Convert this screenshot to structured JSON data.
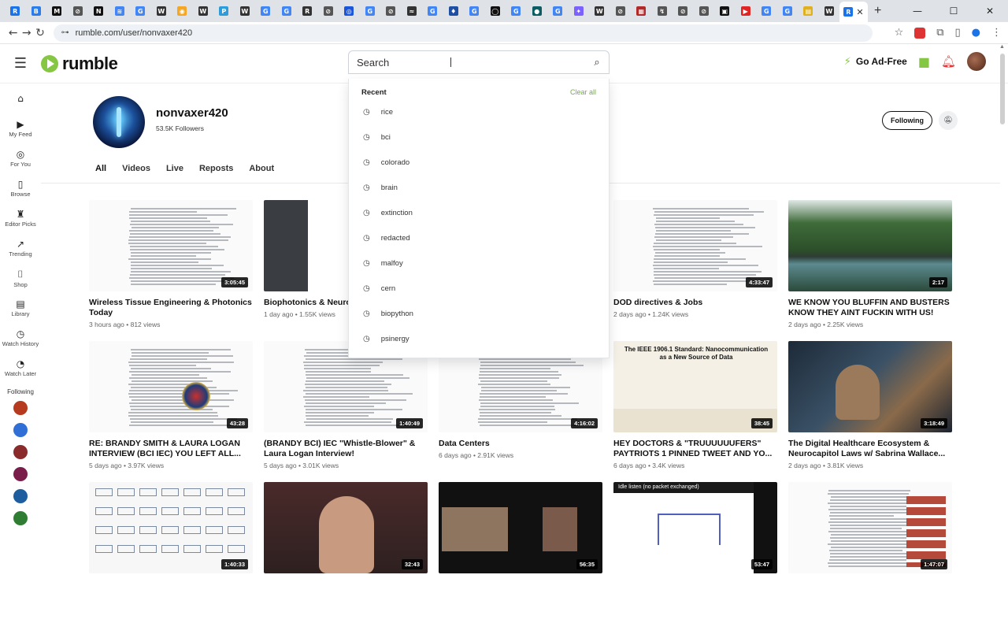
{
  "browser": {
    "tab_favicons": [
      {
        "color": "#1a73e8",
        "glyph": "R",
        "name": "rumble-tab-icon"
      },
      {
        "color": "#2b7de9",
        "glyph": "B",
        "name": "tab-icon-b"
      },
      {
        "color": "#111111",
        "glyph": "M",
        "name": "tab-icon-m"
      },
      {
        "color": "#555555",
        "glyph": "⊘",
        "name": "tab-icon-circle"
      },
      {
        "color": "#111111",
        "glyph": "N",
        "name": "tab-icon-n"
      },
      {
        "color": "#4285f4",
        "glyph": "≋",
        "name": "tab-icon-wave"
      },
      {
        "color": "#4285f4",
        "glyph": "G",
        "name": "google-tab-icon"
      },
      {
        "color": "#333333",
        "glyph": "W",
        "name": "wikipedia-tab-icon"
      },
      {
        "color": "#f5a623",
        "glyph": "◉",
        "name": "tab-icon-orange"
      },
      {
        "color": "#333333",
        "glyph": "W",
        "name": "wikipedia-tab-icon"
      },
      {
        "color": "#2d9cdb",
        "glyph": "P",
        "name": "tab-icon-pm"
      },
      {
        "color": "#333333",
        "glyph": "W",
        "name": "wikipedia-tab-icon"
      },
      {
        "color": "#4285f4",
        "glyph": "G",
        "name": "google-tab-icon"
      },
      {
        "color": "#4285f4",
        "glyph": "G",
        "name": "google-tab-icon"
      },
      {
        "color": "#333333",
        "glyph": "R",
        "name": "tab-icon-r"
      },
      {
        "color": "#555555",
        "glyph": "⊘",
        "name": "tab-icon-circle"
      },
      {
        "color": "#1a56db",
        "glyph": "◎",
        "name": "tab-icon-globe"
      },
      {
        "color": "#4285f4",
        "glyph": "G",
        "name": "google-tab-icon"
      },
      {
        "color": "#555555",
        "glyph": "⊘",
        "name": "tab-icon-circle"
      },
      {
        "color": "#333333",
        "glyph": "≈",
        "name": "tab-icon-ncbi"
      },
      {
        "color": "#4285f4",
        "glyph": "G",
        "name": "google-tab-icon"
      },
      {
        "color": "#1f4fa3",
        "glyph": "♦",
        "name": "tab-icon-shield"
      },
      {
        "color": "#4285f4",
        "glyph": "G",
        "name": "google-tab-icon"
      },
      {
        "color": "#111111",
        "glyph": "◯",
        "name": "github-tab-icon"
      },
      {
        "color": "#4285f4",
        "glyph": "G",
        "name": "google-tab-icon"
      },
      {
        "color": "#0b5d63",
        "glyph": "●",
        "name": "tab-icon-teal"
      },
      {
        "color": "#4285f4",
        "glyph": "G",
        "name": "google-tab-icon"
      },
      {
        "color": "#7b61ff",
        "glyph": "✦",
        "name": "tab-icon-purple"
      },
      {
        "color": "#333333",
        "glyph": "W",
        "name": "wikipedia-tab-icon"
      },
      {
        "color": "#555555",
        "glyph": "⊘",
        "name": "tab-icon-circle"
      },
      {
        "color": "#b02a2a",
        "glyph": "▦",
        "name": "tab-icon-red"
      },
      {
        "color": "#555555",
        "glyph": "↯",
        "name": "tab-icon-plug"
      },
      {
        "color": "#555555",
        "glyph": "⊘",
        "name": "tab-icon-circle"
      },
      {
        "color": "#555555",
        "glyph": "⊘",
        "name": "tab-icon-circle"
      },
      {
        "color": "#111111",
        "glyph": "▣",
        "name": "tab-icon-square"
      },
      {
        "color": "#e02424",
        "glyph": "▶",
        "name": "youtube-tab-icon"
      },
      {
        "color": "#4285f4",
        "glyph": "G",
        "name": "google-tab-icon"
      },
      {
        "color": "#4285f4",
        "glyph": "G",
        "name": "google-tab-icon"
      },
      {
        "color": "#e0b020",
        "glyph": "▤",
        "name": "tab-icon-yellow"
      },
      {
        "color": "#333333",
        "glyph": "W",
        "name": "wikipedia-tab-icon"
      },
      {
        "color": "#1a73e8",
        "glyph": "R",
        "name": "rumble-tab-icon"
      }
    ],
    "url": "rumble.com/user/nonvaxer420"
  },
  "header": {
    "logo_text": "rumble",
    "search_placeholder": "Search",
    "ad_free_label": "Go Ad-Free"
  },
  "search_dropdown": {
    "heading": "Recent",
    "clear_label": "Clear all",
    "items": [
      "rice",
      "bci",
      "colorado",
      "brain",
      "extinction",
      "redacted",
      "malfoy",
      "cern",
      "biopython",
      "psinergy"
    ]
  },
  "sidebar": {
    "items": [
      {
        "icon": "⌂",
        "label": "",
        "name": "sidebar-item-home",
        "icon_name": "home-icon"
      },
      {
        "icon": "▶",
        "label": "My Feed",
        "name": "sidebar-item-my-feed",
        "icon_name": "feed-icon"
      },
      {
        "icon": "◎",
        "label": "For You",
        "name": "sidebar-item-for-you",
        "icon_name": "compass-icon"
      },
      {
        "icon": "▯",
        "label": "Browse",
        "name": "sidebar-item-browse",
        "icon_name": "browse-icon"
      },
      {
        "icon": "♜",
        "label": "Editor Picks",
        "name": "sidebar-item-editor-picks",
        "icon_name": "trophy-icon"
      },
      {
        "icon": "↗",
        "label": "Trending",
        "name": "sidebar-item-trending",
        "icon_name": "trending-icon"
      },
      {
        "icon": "⌷",
        "label": "Shop",
        "name": "sidebar-item-shop",
        "icon_name": "shop-icon"
      },
      {
        "icon": "▤",
        "label": "Library",
        "name": "sidebar-item-library",
        "icon_name": "library-icon"
      },
      {
        "icon": "◷",
        "label": "Watch History",
        "name": "sidebar-item-watch-history",
        "icon_name": "history-icon"
      },
      {
        "icon": "◔",
        "label": "Watch Later",
        "name": "sidebar-item-watch-later",
        "icon_name": "clock-icon"
      }
    ],
    "following_label": "Following",
    "channel_colors": [
      "#b53a1e",
      "#2f6fd6",
      "#8a2a2a",
      "#7a1d4a",
      "#1f5e9e",
      "#2e7d32"
    ]
  },
  "channel": {
    "name": "nonvaxer420",
    "followers": "53.5K Followers",
    "following_label": "Following",
    "tabs": [
      "All",
      "Videos",
      "Live",
      "Reposts",
      "About"
    ]
  },
  "videos": [
    {
      "title": "Wireless Tissue Engineering & Photonics Today",
      "meta": "3 hours ago • 812  views",
      "duration": "3:05:45",
      "thumb": "doc"
    },
    {
      "title": "Biophotonics & Neuro...",
      "meta": "1 day ago • 1.55K  views",
      "duration": "",
      "thumb": "doc-dark"
    },
    {
      "title": "",
      "meta": "",
      "duration": "",
      "thumb": "hidden"
    },
    {
      "title": "DOD directives & Jobs",
      "meta": "2 days ago • 1.24K  views",
      "duration": "4:33:47",
      "thumb": "doc"
    },
    {
      "title": "WE KNOW YOU BLUFFIN AND BUSTERS KNOW THEY AINT FUCKIN WITH US!",
      "meta": "2 days ago • 2.25K  views",
      "duration": "2:17",
      "thumb": "lake"
    },
    {
      "title": "RE: BRANDY SMITH & LAURA LOGAN INTERVIEW (BCI IEC) YOU LEFT ALL...",
      "meta": "5 days ago • 3.97K  views",
      "duration": "43:28",
      "thumb": "doc-seal"
    },
    {
      "title": "(BRANDY BCI) IEC \"Whistle-Blower\" & Laura Logan Interview!",
      "meta": "5 days ago • 3.01K  views",
      "duration": "1:40:49",
      "thumb": "doc"
    },
    {
      "title": "Data Centers",
      "meta": "6 days ago • 2.91K  views",
      "duration": "4:16:02",
      "thumb": "doc"
    },
    {
      "title": "HEY DOCTORS & \"TRUUUUUUFERS\" PAYTRIOTS 1 PINNED TWEET AND YO...",
      "meta": "6 days ago • 3.4K  views",
      "duration": "38:45",
      "thumb": "slide"
    },
    {
      "title": "The Digital Healthcare Ecosystem & Neurocapitol Laws w/ Sabrina Wallace...",
      "meta": "2 days ago • 3.81K  views",
      "duration": "3:18:49",
      "thumb": "stream"
    },
    {
      "title": "",
      "meta": "",
      "duration": "1:40:33",
      "thumb": "diagram"
    },
    {
      "title": "",
      "meta": "",
      "duration": "32:43",
      "thumb": "person"
    },
    {
      "title": "",
      "meta": "",
      "duration": "56:35",
      "thumb": "zoom"
    },
    {
      "title": "",
      "meta": "",
      "duration": "53:47",
      "thumb": "graph"
    },
    {
      "title": "",
      "meta": "",
      "duration": "1:47:07",
      "thumb": "youtube"
    }
  ],
  "thumb_texts": {
    "slide_title": "The IEEE 1906.1 Standard: Nanocommunication as a New Source of Data",
    "graph_label": "Idle listen (no packet exchanged)"
  },
  "colors": {
    "accent": "#85c742",
    "clear_link": "#6fae3a"
  }
}
